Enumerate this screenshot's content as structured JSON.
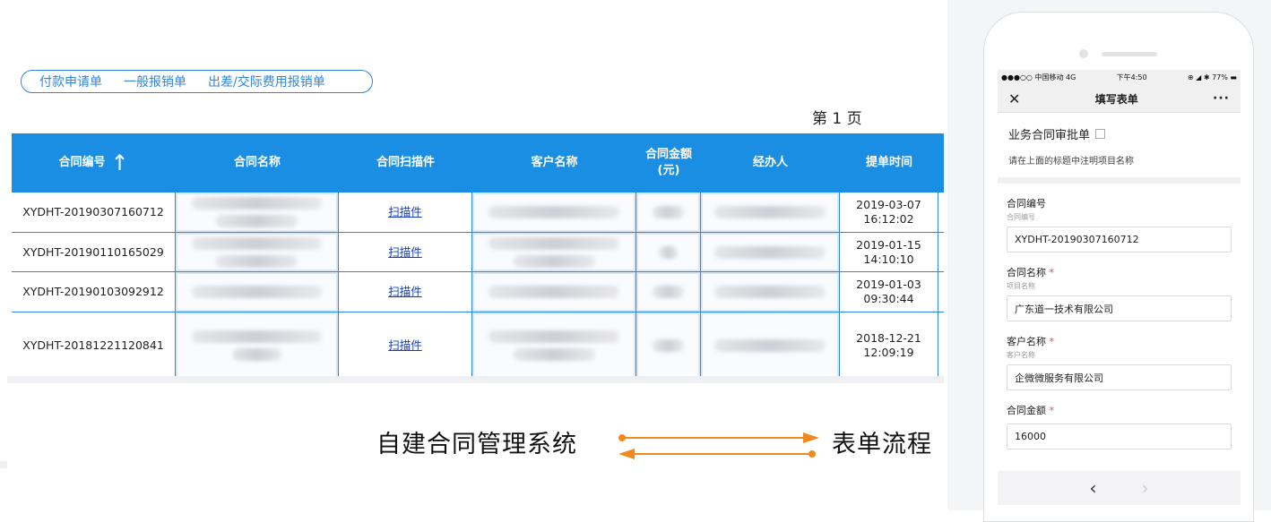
{
  "top_links": [
    "付款申请单",
    "一般报销单",
    "出差/交际费用报销单"
  ],
  "page_indicator": "第 1 页",
  "table": {
    "headers": [
      "合同编号",
      "合同名称",
      "合同扫描件",
      "客户名称",
      "合同金额(元)",
      "经办人",
      "提单时间"
    ],
    "sort_arrow": "↑",
    "rows": [
      {
        "id": "XYDHT-20190307160712",
        "scan": "扫描件",
        "date": "2019-03-07",
        "time": "16:12:02"
      },
      {
        "id": "XYDHT-20190110165029",
        "scan": "扫描件",
        "date": "2019-01-15",
        "time": "14:10:10"
      },
      {
        "id": "XYDHT-20190103092912",
        "scan": "扫描件",
        "date": "2019-01-03",
        "time": "09:30:44"
      },
      {
        "id": "XYDHT-20181221120841",
        "scan": "扫描件",
        "date": "2018-12-21",
        "time": "12:09:19"
      }
    ]
  },
  "labels": {
    "left": "自建合同管理系统",
    "right": "表单流程"
  },
  "colors": {
    "accent": "#1a8ee3",
    "arrow": "#f08a1c",
    "required": "#e24a3b"
  },
  "phone": {
    "status": {
      "carrier": "●●●○○ 中国移动  4G",
      "time": "下午4:50",
      "battery": "⊕ ◢ ✱ 77% ▬"
    },
    "nav": {
      "close": "✕",
      "title": "填写表单",
      "more": "···"
    },
    "form_title": "业务合同审批单",
    "form_subtitle": "请在上面的标题中注明项目名称",
    "fields": [
      {
        "label": "合同编号",
        "required": "",
        "hint": "合同编号",
        "value": "XYDHT-20190307160712"
      },
      {
        "label": "合同名称",
        "required": "*",
        "hint": "项目名称",
        "value": "广东道一技术有限公司"
      },
      {
        "label": "客户名称",
        "required": "*",
        "hint": "客户名称",
        "value": "企微微服务有限公司"
      },
      {
        "label": "合同金额",
        "required": "*",
        "hint": "",
        "value": "16000"
      }
    ],
    "bottom": {
      "prev": "‹",
      "next": "›"
    }
  }
}
